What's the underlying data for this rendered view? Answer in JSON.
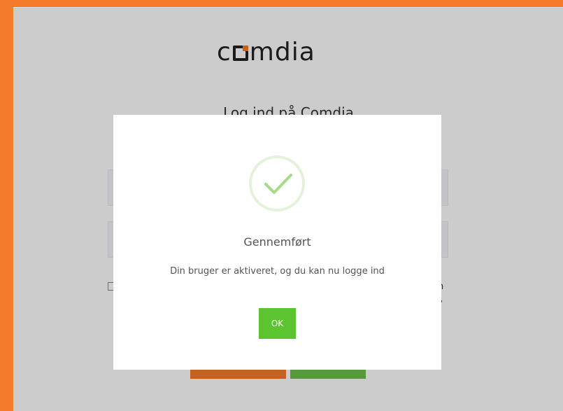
{
  "brand": {
    "logo_left": "c",
    "logo_right": "mdia",
    "accent_color": "#f47b2a"
  },
  "login": {
    "title": "Log ind på Comdia",
    "side_text_1": "n",
    "side_text_2": "?"
  },
  "modal": {
    "icon": "success-check-icon",
    "title": "Gennemført",
    "message": "Din bruger er aktiveret, og du kan nu logge ind",
    "ok_label": "OK",
    "ok_color": "#5cc431"
  }
}
